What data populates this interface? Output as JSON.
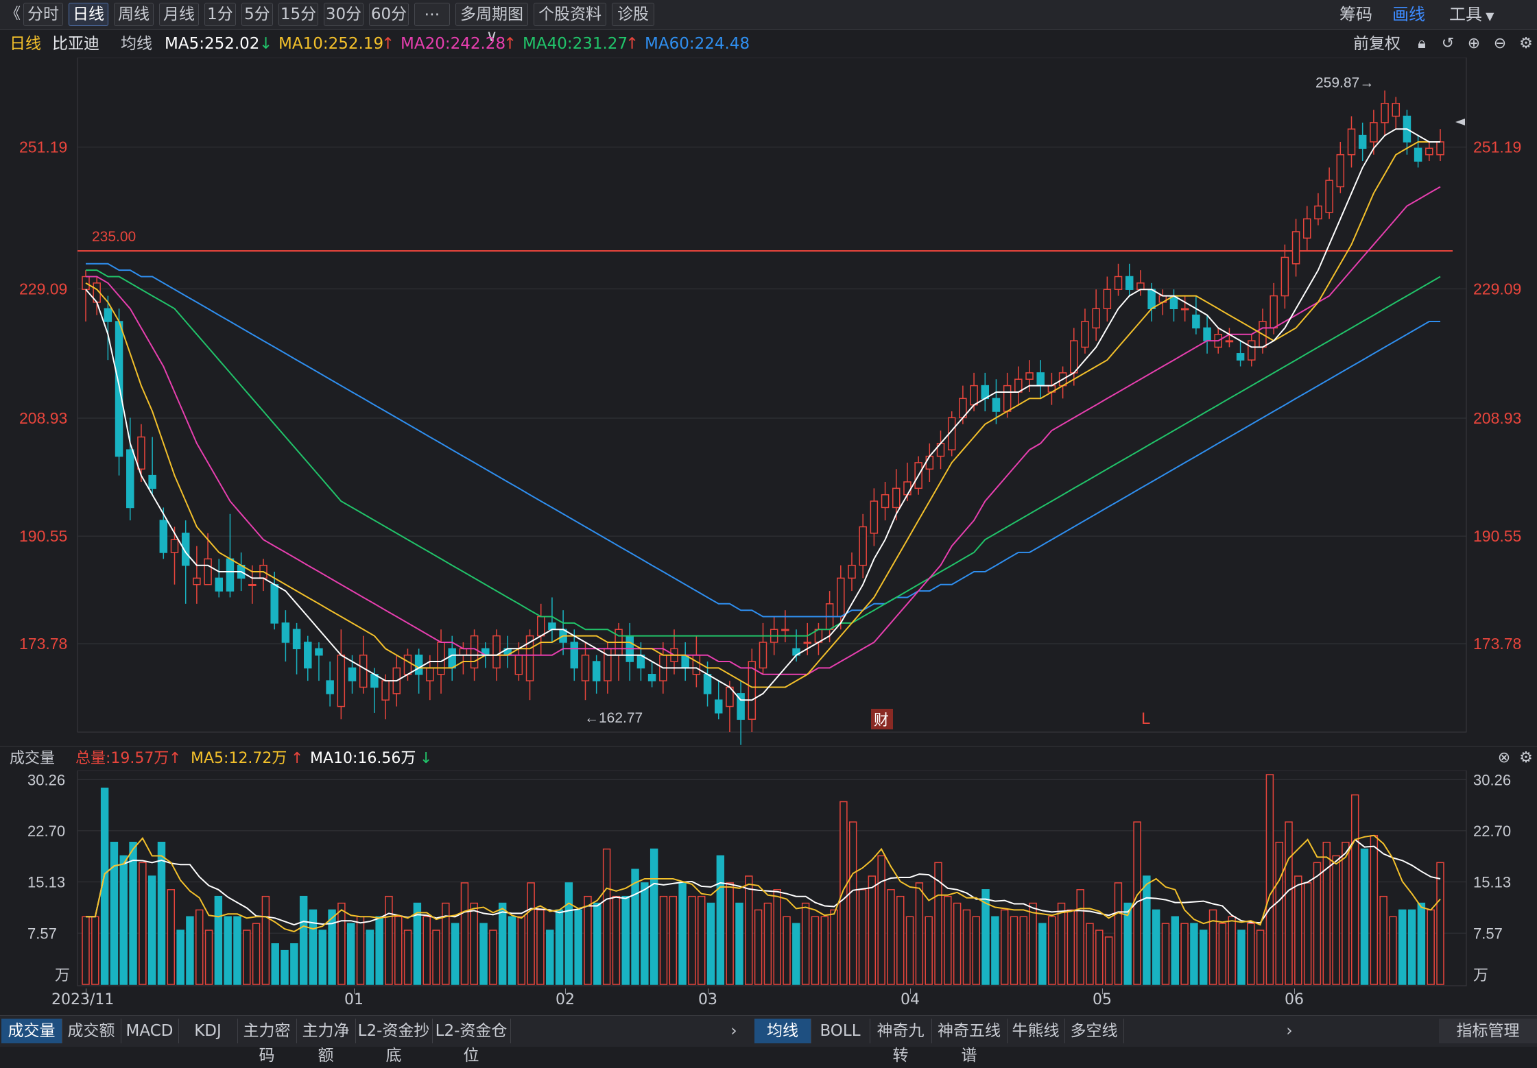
{
  "toolbar": {
    "back_label": "《",
    "tabs": [
      "分时",
      "日线",
      "周线",
      "月线",
      "1分",
      "5分",
      "15分",
      "30分",
      "60分",
      "⋯",
      "多周期图 ∨",
      "个股资料",
      "诊股"
    ],
    "active_tab": "日线",
    "right": [
      "筹码",
      "画线",
      "工具"
    ]
  },
  "info": {
    "period": "日线",
    "stock_name": "比亚迪",
    "ma_label": "均线",
    "ma5": "MA5:252.02",
    "ma10": "MA10:252.19",
    "ma20": "MA20:242.28",
    "ma40": "MA40:231.27",
    "ma60": "MA60:224.48",
    "adjust": "前复权",
    "colors": {
      "ma5": "#ffffff",
      "ma10": "#f4c12b",
      "ma20": "#e83fb0",
      "ma40": "#21c46a",
      "ma60": "#2f8ff0",
      "up": "#e8453c",
      "down": "#19b3c2",
      "label": "#e8453c"
    }
  },
  "price_axis": {
    "labels": [
      "251.19",
      "229.09",
      "208.93",
      "190.55",
      "173.78"
    ]
  },
  "annotations": {
    "high": "259.87→",
    "low": "←162.77",
    "hline": "235.00",
    "fin_marker": "财",
    "l_marker": "L"
  },
  "volume": {
    "title": "成交量",
    "total": "总量:19.57万",
    "ma5": "MA5:12.72万",
    "ma10": "MA10:16.56万",
    "axis": [
      "30.26",
      "22.70",
      "15.13",
      "7.57",
      "万"
    ]
  },
  "x_axis": [
    "2023/11",
    "01",
    "02",
    "03",
    "04",
    "05",
    "06"
  ],
  "bottom_tabs_left": [
    "成交量",
    "成交额",
    "MACD",
    "KDJ",
    "主力密码",
    "主力净额",
    "L2-资金抄底",
    "L2-资金仓位"
  ],
  "bottom_tabs_right": [
    "均线",
    "BOLL",
    "神奇九转",
    "神奇五线谱",
    "牛熊线",
    "多空线"
  ],
  "bottom_manage": "指标管理",
  "chart_data": {
    "type": "candlestick",
    "price_range": [
      160,
      263
    ],
    "candles": [
      [
        229,
        231,
        224,
        232
      ],
      [
        227,
        230,
        225,
        231
      ],
      [
        226,
        224,
        218,
        228
      ],
      [
        224,
        203,
        200,
        226
      ],
      [
        204,
        195,
        193,
        209
      ],
      [
        201,
        206,
        199,
        208
      ],
      [
        200,
        198,
        197,
        206
      ],
      [
        193,
        188,
        187,
        195
      ],
      [
        188,
        190,
        183,
        192
      ],
      [
        191,
        186,
        180,
        193
      ],
      [
        183,
        184,
        180,
        189
      ],
      [
        183,
        187,
        183,
        191
      ],
      [
        184,
        182,
        181,
        187
      ],
      [
        187,
        182,
        181,
        194
      ],
      [
        186,
        184,
        182,
        188
      ],
      [
        183,
        183,
        180,
        186
      ],
      [
        184,
        186,
        182,
        187
      ],
      [
        183,
        177,
        176,
        185
      ],
      [
        177,
        174,
        171,
        179
      ],
      [
        176,
        173,
        169,
        177
      ],
      [
        174,
        170,
        168,
        175
      ],
      [
        173,
        172,
        168,
        174
      ],
      [
        168,
        166,
        164,
        171
      ],
      [
        164,
        172,
        162,
        176
      ],
      [
        170,
        168,
        166,
        172
      ],
      [
        167,
        172,
        166,
        175
      ],
      [
        169,
        167,
        163,
        170
      ],
      [
        165,
        168,
        162,
        169
      ],
      [
        166,
        170,
        164,
        172
      ],
      [
        169,
        172,
        168,
        173
      ],
      [
        172,
        169,
        166,
        173
      ],
      [
        168,
        170,
        165,
        172
      ],
      [
        169,
        174,
        166,
        176
      ],
      [
        173,
        170,
        168,
        175
      ],
      [
        172,
        173,
        169,
        174
      ],
      [
        170,
        175,
        168,
        176
      ],
      [
        173,
        172,
        170,
        174
      ],
      [
        170,
        175,
        168,
        176
      ],
      [
        173,
        172,
        170,
        175
      ],
      [
        169,
        172,
        168,
        174
      ],
      [
        168,
        175,
        165,
        176
      ],
      [
        175,
        178,
        172,
        180
      ],
      [
        177,
        176,
        174,
        181
      ],
      [
        176,
        174,
        172,
        179
      ],
      [
        174,
        170,
        168,
        176
      ],
      [
        168,
        172,
        165,
        174
      ],
      [
        171,
        168,
        166,
        172
      ],
      [
        168,
        173,
        166,
        174
      ],
      [
        172,
        176,
        168,
        177
      ],
      [
        175,
        171,
        168,
        177
      ],
      [
        172,
        170,
        168,
        174
      ],
      [
        169,
        168,
        167,
        171
      ],
      [
        168,
        172,
        166,
        174
      ],
      [
        171,
        173,
        169,
        176
      ],
      [
        172,
        170,
        168,
        174
      ],
      [
        169,
        172,
        167,
        175
      ],
      [
        169,
        166,
        164,
        171
      ],
      [
        165,
        163,
        162,
        168
      ],
      [
        164,
        167,
        160,
        168
      ],
      [
        166,
        162,
        158,
        168
      ],
      [
        162,
        171,
        160,
        173
      ],
      [
        170,
        174,
        169,
        177
      ],
      [
        174,
        176,
        172,
        178
      ],
      [
        176,
        176,
        174,
        179
      ],
      [
        173,
        172,
        171,
        176
      ],
      [
        174,
        174,
        172,
        177
      ],
      [
        174,
        176,
        172,
        177
      ],
      [
        176,
        180,
        174,
        182
      ],
      [
        178,
        184,
        176,
        186
      ],
      [
        184,
        186,
        182,
        188
      ],
      [
        186,
        192,
        184,
        194
      ],
      [
        191,
        196,
        189,
        198
      ],
      [
        195,
        197,
        193,
        199
      ],
      [
        195,
        198,
        193,
        201
      ],
      [
        197,
        199,
        196,
        202
      ],
      [
        198,
        202,
        197,
        203
      ],
      [
        201,
        203,
        199,
        205
      ],
      [
        203,
        205,
        201,
        207
      ],
      [
        204,
        209,
        203,
        210
      ],
      [
        209,
        212,
        208,
        214
      ],
      [
        211,
        214,
        210,
        216
      ],
      [
        214,
        212,
        210,
        216
      ],
      [
        212,
        210,
        208,
        215
      ],
      [
        210,
        214,
        209,
        216
      ],
      [
        213,
        215,
        211,
        217
      ],
      [
        215,
        216,
        213,
        218
      ],
      [
        216,
        214,
        212,
        218
      ],
      [
        213,
        214,
        211,
        216
      ],
      [
        214,
        216,
        212,
        217
      ],
      [
        216,
        221,
        214,
        223
      ],
      [
        220,
        224,
        219,
        226
      ],
      [
        223,
        226,
        221,
        229
      ],
      [
        226,
        229,
        224,
        231
      ],
      [
        229,
        231,
        228,
        233
      ],
      [
        231,
        229,
        228,
        233
      ],
      [
        229,
        230,
        228,
        232
      ],
      [
        229,
        226,
        224,
        230
      ],
      [
        227,
        228,
        225,
        229
      ],
      [
        228,
        226,
        224,
        229
      ],
      [
        226,
        226,
        224,
        228
      ],
      [
        225,
        223,
        222,
        228
      ],
      [
        223,
        221,
        219,
        225
      ],
      [
        220,
        222,
        219,
        223
      ],
      [
        221,
        221,
        220,
        223
      ],
      [
        219,
        218,
        217,
        221
      ],
      [
        218,
        221,
        217,
        222
      ],
      [
        220,
        224,
        219,
        226
      ],
      [
        223,
        228,
        222,
        230
      ],
      [
        228,
        234,
        226,
        236
      ],
      [
        233,
        238,
        231,
        240
      ],
      [
        237,
        240,
        235,
        242
      ],
      [
        240,
        242,
        239,
        244
      ],
      [
        241,
        246,
        240,
        248
      ],
      [
        245,
        250,
        244,
        252
      ],
      [
        250,
        254,
        248,
        256
      ],
      [
        253,
        251,
        249,
        255
      ],
      [
        252,
        255,
        250,
        257
      ],
      [
        255,
        258,
        253,
        260
      ],
      [
        256,
        258,
        254,
        259
      ],
      [
        256,
        252,
        250,
        257
      ],
      [
        251,
        249,
        248,
        253
      ],
      [
        250,
        251,
        249,
        252
      ],
      [
        250,
        252,
        249,
        254
      ]
    ],
    "ma5": [
      229,
      227,
      222,
      214,
      205,
      200,
      197,
      194,
      191,
      188,
      186,
      186,
      185,
      185,
      185,
      184,
      184,
      183,
      182,
      180,
      178,
      176,
      174,
      172,
      171,
      170,
      169,
      168,
      168,
      169,
      170,
      171,
      171,
      172,
      172,
      172,
      172,
      172,
      173,
      173,
      174,
      175,
      176,
      176,
      175,
      174,
      173,
      172,
      172,
      172,
      172,
      171,
      170,
      170,
      170,
      170,
      169,
      168,
      167,
      165,
      165,
      166,
      168,
      170,
      172,
      173,
      174,
      175,
      177,
      180,
      183,
      187,
      190,
      194,
      197,
      200,
      203,
      205,
      207,
      209,
      211,
      212,
      213,
      213,
      213,
      214,
      214,
      214,
      215,
      216,
      218,
      220,
      223,
      226,
      228,
      229,
      229,
      228,
      228,
      227,
      226,
      225,
      223,
      222,
      221,
      220,
      220,
      221,
      223,
      226,
      229,
      232,
      236,
      240,
      244,
      248,
      251,
      253,
      254,
      254,
      253,
      252,
      252
    ],
    "ma10": [
      230,
      229,
      227,
      224,
      219,
      214,
      210,
      205,
      200,
      196,
      192,
      190,
      188,
      187,
      186,
      185,
      185,
      184,
      183,
      182,
      181,
      180,
      179,
      178,
      177,
      176,
      175,
      173,
      172,
      171,
      170,
      170,
      170,
      170,
      171,
      171,
      172,
      172,
      172,
      173,
      173,
      174,
      174,
      175,
      175,
      175,
      175,
      174,
      174,
      174,
      173,
      173,
      172,
      172,
      172,
      171,
      170,
      170,
      169,
      168,
      167,
      167,
      167,
      167,
      168,
      169,
      171,
      173,
      175,
      177,
      179,
      181,
      184,
      187,
      190,
      193,
      196,
      199,
      202,
      204,
      206,
      208,
      209,
      210,
      211,
      212,
      212,
      213,
      214,
      215,
      216,
      217,
      218,
      220,
      222,
      224,
      226,
      227,
      228,
      228,
      228,
      227,
      226,
      225,
      224,
      223,
      222,
      221,
      222,
      223,
      225,
      227,
      230,
      233,
      236,
      240,
      244,
      247,
      250,
      251,
      252,
      252,
      252
    ],
    "ma20": [
      231,
      231,
      230,
      228,
      226,
      223,
      220,
      217,
      213,
      209,
      205,
      202,
      199,
      196,
      194,
      192,
      190,
      189,
      188,
      187,
      186,
      185,
      184,
      183,
      182,
      181,
      180,
      179,
      178,
      177,
      176,
      175,
      174,
      174,
      173,
      173,
      172,
      172,
      172,
      172,
      172,
      172,
      172,
      173,
      173,
      173,
      173,
      173,
      173,
      173,
      173,
      173,
      173,
      172,
      172,
      172,
      172,
      171,
      171,
      170,
      170,
      169,
      169,
      169,
      169,
      169,
      170,
      170,
      171,
      172,
      173,
      174,
      176,
      178,
      180,
      182,
      184,
      186,
      189,
      191,
      193,
      196,
      198,
      200,
      202,
      204,
      205,
      207,
      208,
      209,
      210,
      211,
      212,
      213,
      214,
      215,
      216,
      217,
      218,
      219,
      220,
      221,
      221,
      222,
      222,
      222,
      223,
      223,
      224,
      225,
      226,
      227,
      228,
      230,
      232,
      234,
      236,
      238,
      240,
      242,
      243,
      244,
      245
    ],
    "ma40": [
      232,
      232,
      231,
      231,
      230,
      229,
      228,
      227,
      226,
      224,
      222,
      220,
      218,
      216,
      214,
      212,
      210,
      208,
      206,
      204,
      202,
      200,
      198,
      196,
      195,
      194,
      193,
      192,
      191,
      190,
      189,
      188,
      187,
      186,
      185,
      184,
      183,
      182,
      181,
      180,
      179,
      178,
      178,
      177,
      177,
      176,
      176,
      176,
      175,
      175,
      175,
      175,
      175,
      175,
      175,
      175,
      175,
      175,
      175,
      175,
      175,
      175,
      175,
      175,
      175,
      175,
      176,
      176,
      177,
      177,
      178,
      179,
      180,
      181,
      182,
      183,
      184,
      185,
      186,
      187,
      188,
      190,
      191,
      192,
      193,
      194,
      195,
      196,
      197,
      198,
      199,
      200,
      201,
      202,
      203,
      204,
      205,
      206,
      207,
      208,
      209,
      210,
      211,
      212,
      213,
      214,
      215,
      216,
      217,
      218,
      219,
      220,
      221,
      222,
      223,
      224,
      225,
      226,
      227,
      228,
      229,
      230,
      231
    ],
    "ma60": [
      233,
      233,
      233,
      232,
      232,
      231,
      231,
      230,
      229,
      228,
      227,
      226,
      225,
      224,
      223,
      222,
      221,
      220,
      219,
      218,
      217,
      216,
      215,
      214,
      213,
      212,
      211,
      210,
      209,
      208,
      207,
      206,
      205,
      204,
      203,
      202,
      201,
      200,
      199,
      198,
      197,
      196,
      195,
      194,
      193,
      192,
      191,
      190,
      189,
      188,
      187,
      186,
      185,
      184,
      183,
      182,
      181,
      180,
      180,
      179,
      179,
      178,
      178,
      178,
      178,
      178,
      178,
      178,
      178,
      179,
      179,
      180,
      180,
      181,
      181,
      182,
      182,
      183,
      183,
      184,
      185,
      185,
      186,
      187,
      188,
      188,
      189,
      190,
      191,
      192,
      193,
      194,
      195,
      196,
      197,
      198,
      199,
      200,
      201,
      202,
      203,
      204,
      205,
      206,
      207,
      208,
      209,
      210,
      211,
      212,
      213,
      214,
      215,
      216,
      217,
      218,
      219,
      220,
      221,
      222,
      223,
      224,
      224
    ],
    "vol_range": [
      0,
      31
    ],
    "volumes": [
      10,
      10,
      29,
      21,
      19,
      21,
      18,
      16,
      21,
      14,
      8,
      10,
      11,
      8,
      13,
      10,
      10,
      8,
      9,
      13,
      6,
      5,
      6,
      13,
      11,
      8,
      11,
      12,
      9,
      10,
      8,
      10,
      13,
      10,
      8,
      12,
      10,
      8,
      12,
      9,
      15,
      12,
      9,
      8,
      12,
      10,
      10,
      15,
      11,
      8,
      11,
      15,
      11,
      13,
      12,
      20,
      13,
      13,
      17,
      15,
      20,
      13,
      13,
      15,
      13,
      13,
      12,
      19,
      15,
      12,
      16,
      11,
      12,
      14,
      10,
      9,
      12,
      10,
      10,
      11,
      27,
      24,
      14,
      16,
      19,
      14,
      13,
      10,
      15,
      10,
      18,
      13,
      12,
      11,
      10,
      14,
      10,
      11,
      10,
      10,
      12,
      9,
      10,
      12,
      11,
      14,
      9,
      8,
      7,
      15,
      12,
      24,
      16,
      11,
      9,
      10,
      9,
      9,
      8,
      11,
      9,
      10,
      8,
      9,
      8,
      31,
      21,
      24,
      16,
      15,
      18,
      21,
      19,
      21,
      28,
      20,
      22,
      13,
      10,
      11,
      11,
      12,
      11,
      18
    ]
  }
}
